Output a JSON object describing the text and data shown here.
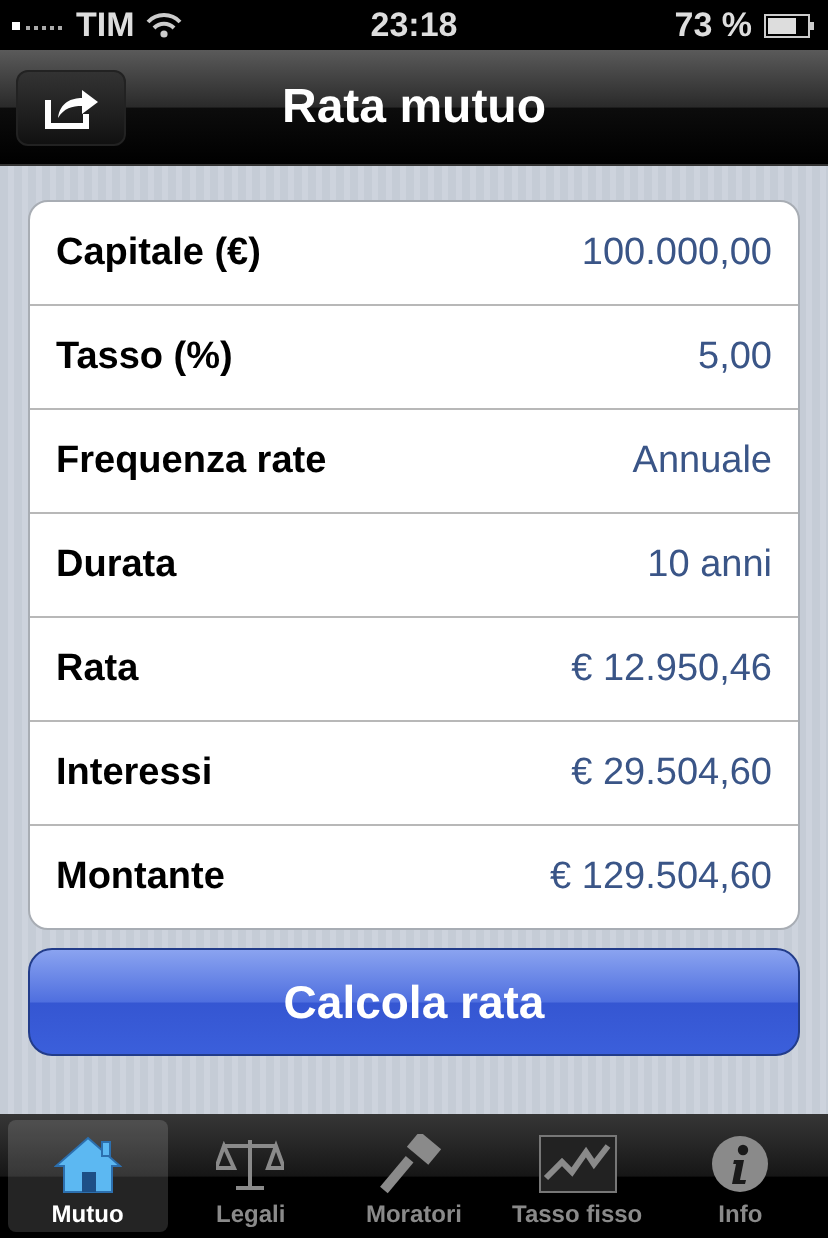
{
  "status_bar": {
    "carrier": "TIM",
    "time": "23:18",
    "battery": "73 %"
  },
  "nav_bar": {
    "title": "Rata mutuo"
  },
  "fields": [
    {
      "label": "Capitale (€)",
      "value": "100.000,00"
    },
    {
      "label": "Tasso (%)",
      "value": "5,00"
    },
    {
      "label": "Frequenza rate",
      "value": "Annuale"
    },
    {
      "label": "Durata",
      "value": "10 anni"
    },
    {
      "label": "Rata",
      "value": "€ 12.950,46"
    },
    {
      "label": "Interessi",
      "value": "€ 29.504,60"
    },
    {
      "label": "Montante",
      "value": "€ 129.504,60"
    }
  ],
  "button": "Calcola rata",
  "tabs": [
    {
      "label": "Mutuo",
      "selected": true
    },
    {
      "label": "Legali",
      "selected": false
    },
    {
      "label": "Moratori",
      "selected": false
    },
    {
      "label": "Tasso fisso",
      "selected": false
    },
    {
      "label": "Info",
      "selected": false
    }
  ]
}
